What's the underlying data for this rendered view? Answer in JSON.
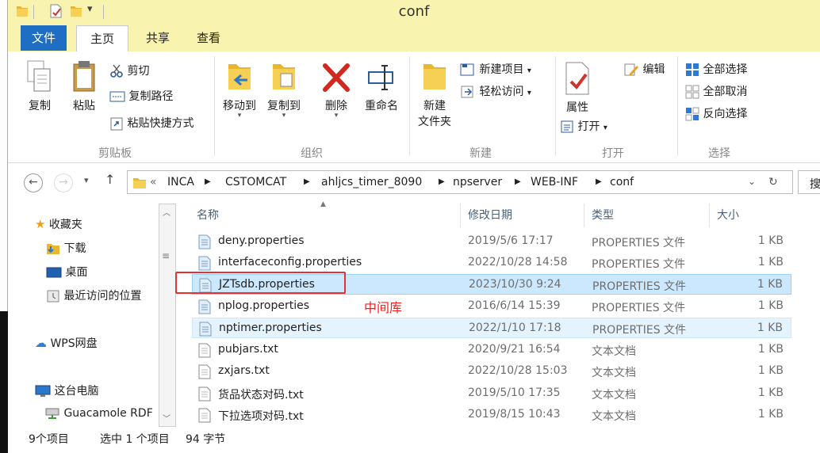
{
  "window": {
    "title": "conf"
  },
  "tabs": [
    "文件",
    "主页",
    "共享",
    "查看"
  ],
  "ribbon": {
    "clipboard": {
      "label": "剪贴板",
      "copy": "复制",
      "paste": "粘贴",
      "cut": "剪切",
      "copy_path": "复制路径",
      "paste_shortcut": "粘贴快捷方式"
    },
    "organize": {
      "label": "组织",
      "move_to": "移动到",
      "copy_to": "复制到",
      "delete": "删除",
      "rename": "重命名"
    },
    "new": {
      "label": "新建",
      "new_folder_line1": "新建",
      "new_folder_line2": "文件夹",
      "new_item": "新建项目",
      "easy_access": "轻松访问"
    },
    "open": {
      "label": "打开",
      "properties": "属性",
      "open": "打开",
      "edit": "编辑"
    },
    "select": {
      "label": "选择",
      "select_all": "全部选择",
      "select_none": "全部取消",
      "invert": "反向选择"
    }
  },
  "address": {
    "prefix": "«",
    "crumbs": [
      "INCA",
      "CSTOMCAT",
      "ahljcs_timer_8090",
      "npserver",
      "WEB-INF",
      "conf"
    ],
    "search_placeholder": "搜"
  },
  "navpane": {
    "favorites": "收藏夹",
    "downloads": "下载",
    "desktop": "桌面",
    "recent": "最近访问的位置",
    "wps": "WPS网盘",
    "this_pc": "这台电脑",
    "guacamole": "Guacamole RDF"
  },
  "columns": {
    "name": "名称",
    "date": "修改日期",
    "type": "类型",
    "size": "大小"
  },
  "files": [
    {
      "name": "deny.properties",
      "date": "2019/5/6 17:17",
      "type": "PROPERTIES 文件",
      "size": "1 KB"
    },
    {
      "name": "interfaceconfig.properties",
      "date": "2022/10/28 14:58",
      "type": "PROPERTIES 文件",
      "size": "1 KB"
    },
    {
      "name": "JZTsdb.properties",
      "date": "2023/10/30 9:24",
      "type": "PROPERTIES 文件",
      "size": "1 KB"
    },
    {
      "name": "nplog.properties",
      "date": "2016/6/14 15:39",
      "type": "PROPERTIES 文件",
      "size": "1 KB"
    },
    {
      "name": "nptimer.properties",
      "date": "2022/1/10 17:18",
      "type": "PROPERTIES 文件",
      "size": "1 KB"
    },
    {
      "name": "pubjars.txt",
      "date": "2020/9/21 16:54",
      "type": "文本文档",
      "size": "1 KB"
    },
    {
      "name": "zxjars.txt",
      "date": "2022/10/28 15:03",
      "type": "文本文档",
      "size": "1 KB"
    },
    {
      "name": "货品状态对码.txt",
      "date": "2019/5/10 17:35",
      "type": "文本文档",
      "size": "1 KB"
    },
    {
      "name": "下拉选项对码.txt",
      "date": "2019/8/15 10:43",
      "type": "文本文档",
      "size": "1 KB"
    }
  ],
  "annotation": "中间库",
  "status": {
    "count": "9个项目",
    "selected": "选中 1 个项目",
    "bytes": "94 字节"
  },
  "colors": {
    "accent": "#1e6fc3",
    "titlebar": "#f9f3b0",
    "selected_row": "#cce8ff",
    "annotation": "#ff1818"
  }
}
